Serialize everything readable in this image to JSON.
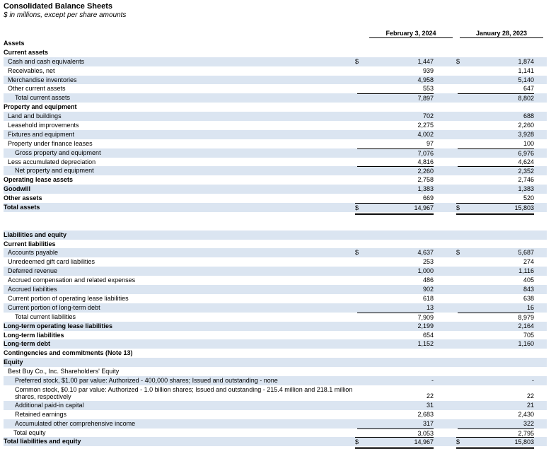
{
  "title": "Consolidated Balance Sheets",
  "subtitle": "$ in millions, except per share amounts",
  "columns": [
    "February 3, 2024",
    "January 28, 2023"
  ],
  "rows": [
    {
      "label": "Assets",
      "style": "b",
      "indent": 0,
      "shade": false
    },
    {
      "label": "Current assets",
      "style": "b",
      "indent": 0,
      "shade": false
    },
    {
      "label": "Cash and cash equivalents",
      "indent": 1,
      "shade": true,
      "d": "$",
      "v1": "1,447",
      "v2": "1,874"
    },
    {
      "label": "Receivables, net",
      "indent": 1,
      "shade": false,
      "v1": "939",
      "v2": "1,141"
    },
    {
      "label": "Merchandise inventories",
      "indent": 1,
      "shade": true,
      "v1": "4,958",
      "v2": "5,140"
    },
    {
      "label": "Other current assets",
      "indent": 1,
      "shade": false,
      "v1": "553",
      "v2": "647"
    },
    {
      "label": "Total current assets",
      "indent": 3,
      "shade": true,
      "v1": "7,897",
      "v2": "8,802",
      "tot": true
    },
    {
      "label": "Property and equipment",
      "style": "b",
      "indent": 0,
      "shade": false
    },
    {
      "label": "Land and buildings",
      "indent": 1,
      "shade": true,
      "v1": "702",
      "v2": "688"
    },
    {
      "label": "Leasehold improvements",
      "indent": 1,
      "shade": false,
      "v1": "2,275",
      "v2": "2,260"
    },
    {
      "label": "Fixtures and equipment",
      "indent": 1,
      "shade": true,
      "v1": "4,002",
      "v2": "3,928"
    },
    {
      "label": "Property under finance leases",
      "indent": 1,
      "shade": false,
      "v1": "97",
      "v2": "100"
    },
    {
      "label": "Gross property and equipment",
      "indent": 3,
      "shade": true,
      "v1": "7,076",
      "v2": "6,976",
      "tot": true
    },
    {
      "label": "Less accumulated depreciation",
      "indent": 1,
      "shade": false,
      "v1": "4,816",
      "v2": "4,624"
    },
    {
      "label": "Net property and equipment",
      "indent": 3,
      "shade": true,
      "v1": "2,260",
      "v2": "2,352",
      "tot": true
    },
    {
      "label": "Operating lease assets",
      "style": "b",
      "indent": 0,
      "shade": false,
      "v1": "2,758",
      "v2": "2,746"
    },
    {
      "label": "Goodwill",
      "style": "b",
      "indent": 0,
      "shade": true,
      "v1": "1,383",
      "v2": "1,383"
    },
    {
      "label": "Other assets",
      "style": "b",
      "indent": 0,
      "shade": false,
      "v1": "669",
      "v2": "520"
    },
    {
      "label": "Total assets",
      "style": "b",
      "indent": 0,
      "shade": true,
      "d": "$",
      "v1": "14,967",
      "v2": "15,803",
      "grand": true
    },
    {
      "gap": true
    },
    {
      "gap": true
    },
    {
      "label": "Liabilities and equity",
      "style": "b",
      "indent": 0,
      "shade": true
    },
    {
      "label": "Current liabilities",
      "style": "b",
      "indent": 0,
      "shade": false
    },
    {
      "label": "Accounts payable",
      "indent": 1,
      "shade": true,
      "d": "$",
      "v1": "4,637",
      "v2": "5,687"
    },
    {
      "label": "Unredeemed gift card liabilities",
      "indent": 1,
      "shade": false,
      "v1": "253",
      "v2": "274"
    },
    {
      "label": "Deferred revenue",
      "indent": 1,
      "shade": true,
      "v1": "1,000",
      "v2": "1,116"
    },
    {
      "label": "Accrued compensation and related expenses",
      "indent": 1,
      "shade": false,
      "v1": "486",
      "v2": "405"
    },
    {
      "label": "Accrued liabilities",
      "indent": 1,
      "shade": true,
      "v1": "902",
      "v2": "843"
    },
    {
      "label": "Current portion of operating lease liabilities",
      "indent": 1,
      "shade": false,
      "v1": "618",
      "v2": "638"
    },
    {
      "label": "Current portion of long-term debt",
      "indent": 1,
      "shade": true,
      "v1": "13",
      "v2": "16"
    },
    {
      "label": "Total current liabilities",
      "indent": 3,
      "shade": false,
      "v1": "7,909",
      "v2": "8,979",
      "tot": true
    },
    {
      "label": "Long-term operating lease liabilities",
      "style": "b",
      "indent": 0,
      "shade": true,
      "v1": "2,199",
      "v2": "2,164"
    },
    {
      "label": "Long-term liabilities",
      "style": "b",
      "indent": 0,
      "shade": false,
      "v1": "654",
      "v2": "705"
    },
    {
      "label": "Long-term debt",
      "style": "b",
      "indent": 0,
      "shade": true,
      "v1": "1,152",
      "v2": "1,160"
    },
    {
      "label": "Contingencies and commitments (Note 13)",
      "style": "b",
      "indent": 0,
      "shade": false
    },
    {
      "label": "Equity",
      "style": "b",
      "indent": 0,
      "shade": true
    },
    {
      "label": "Best Buy Co., Inc. Shareholders' Equity",
      "indent": 1,
      "shade": false
    },
    {
      "label": "Preferred stock, $1.00 par value: Authorized - 400,000 shares; Issued and outstanding - none",
      "indent": 3,
      "shade": true,
      "v1": "-",
      "v2": "-"
    },
    {
      "label": "Common stock, $0.10 par value: Authorized - 1.0 billion shares; Issued and outstanding - 215.4 million and 218.1 million shares, respectively",
      "indent": 3,
      "shade": false,
      "v1": "22",
      "v2": "22",
      "tall": true
    },
    {
      "label": "Additional paid-in capital",
      "indent": 3,
      "shade": true,
      "v1": "31",
      "v2": "21"
    },
    {
      "label": "Retained earnings",
      "indent": 3,
      "shade": false,
      "v1": "2,683",
      "v2": "2,430"
    },
    {
      "label": "Accumulated other comprehensive income",
      "indent": 3,
      "shade": true,
      "v1": "317",
      "v2": "322"
    },
    {
      "label": "Total equity",
      "indent": 2,
      "shade": false,
      "v1": "3,053",
      "v2": "2,795",
      "tot": true
    },
    {
      "label": "Total liabilities and equity",
      "style": "b",
      "indent": 0,
      "shade": true,
      "d": "$",
      "v1": "14,967",
      "v2": "15,803",
      "grand": true
    }
  ]
}
